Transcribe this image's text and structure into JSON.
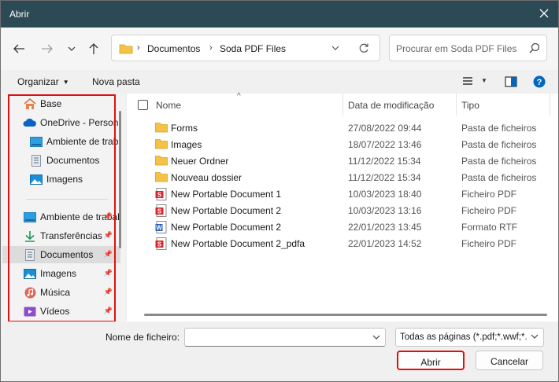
{
  "window": {
    "title": "Abrir"
  },
  "address": {
    "segments": [
      "Documentos",
      "Soda PDF Files"
    ]
  },
  "search": {
    "placeholder": "Procurar em Soda PDF Files"
  },
  "toolbar": {
    "organize_label": "Organizar",
    "new_folder_label": "Nova pasta"
  },
  "sidebar": {
    "items": [
      {
        "label": "Base",
        "icon": "home-icon"
      },
      {
        "label": "OneDrive - Personal",
        "icon": "cloud-icon"
      },
      {
        "label": "Ambiente de trabalho",
        "icon": "desktop-icon"
      },
      {
        "label": "Documentos",
        "icon": "document-icon"
      },
      {
        "label": "Imagens",
        "icon": "image-icon"
      },
      {
        "label": "Ambiente de trabalho",
        "icon": "desktop-icon",
        "pinned": true
      },
      {
        "label": "Transferências",
        "icon": "download-icon",
        "pinned": true
      },
      {
        "label": "Documentos",
        "icon": "document-icon",
        "pinned": true,
        "selected": true
      },
      {
        "label": "Imagens",
        "icon": "image-icon",
        "pinned": true
      },
      {
        "label": "Música",
        "icon": "music-icon",
        "pinned": true
      },
      {
        "label": "Vídeos",
        "icon": "video-icon",
        "pinned": true
      }
    ]
  },
  "files": {
    "columns": {
      "name": "Nome",
      "date": "Data de modificação",
      "type": "Tipo"
    },
    "rows": [
      {
        "name": "Forms",
        "date": "27/08/2022 09:44",
        "type": "Pasta de ficheiros",
        "icon": "folder-icon"
      },
      {
        "name": "Images",
        "date": "18/07/2022 13:46",
        "type": "Pasta de ficheiros",
        "icon": "folder-icon"
      },
      {
        "name": "Neuer Ordner",
        "date": "11/12/2022 15:34",
        "type": "Pasta de ficheiros",
        "icon": "folder-icon"
      },
      {
        "name": "Nouveau dossier",
        "date": "11/12/2022 15:34",
        "type": "Pasta de ficheiros",
        "icon": "folder-icon"
      },
      {
        "name": "New Portable Document 1",
        "date": "10/03/2023 18:40",
        "type": "Ficheiro PDF",
        "icon": "pdf-file-icon"
      },
      {
        "name": "New Portable Document 2",
        "date": "10/03/2023 13:16",
        "type": "Ficheiro PDF",
        "icon": "pdf-file-icon"
      },
      {
        "name": "New Portable Document 2",
        "date": "22/01/2023 13:45",
        "type": "Formato RTF",
        "icon": "word-file-icon"
      },
      {
        "name": "New Portable Document 2_pdfa",
        "date": "22/01/2023 14:52",
        "type": "Ficheiro PDF",
        "icon": "pdf-file-icon"
      }
    ]
  },
  "bottom": {
    "filename_label": "Nome de ficheiro:",
    "filename_value": "",
    "filetype_value": "Todas as páginas (*.pdf;*.wwf;*.",
    "open_label": "Abrir",
    "cancel_label": "Cancelar"
  },
  "colors": {
    "titlebar": "#2b4a55",
    "highlight": "#e01010",
    "folder": "#f4c247",
    "accent": "#0067c0"
  }
}
